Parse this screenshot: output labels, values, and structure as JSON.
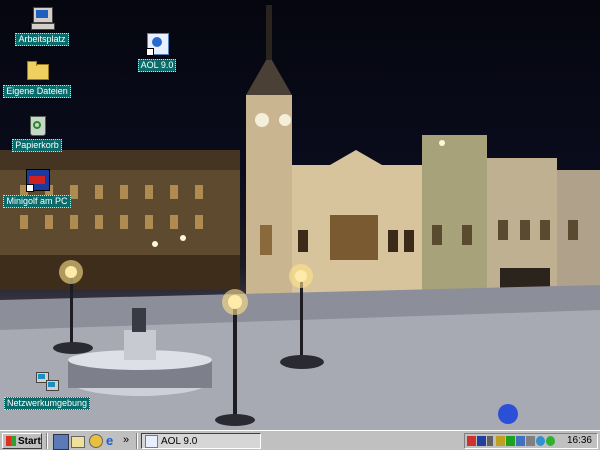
{
  "desktop": {
    "icons": [
      {
        "label": "Arbeitsplatz",
        "icon": "my-computer-icon"
      },
      {
        "label": "AOL 9.0",
        "icon": "aol-icon"
      },
      {
        "label": "Eigene Dateien",
        "icon": "my-documents-folder-icon"
      },
      {
        "label": "Papierkorb",
        "icon": "recycle-bin-icon"
      },
      {
        "label": "Minigolf am PC",
        "icon": "minigolf-game-icon"
      },
      {
        "label": "Netzwerkumgebung",
        "icon": "network-neighborhood-icon"
      }
    ],
    "wallpaper": "night-town-square-snow"
  },
  "taskbar": {
    "start_label": "Start",
    "quick_launch": [
      "show-desktop-icon",
      "outlook-express-icon",
      "media-player-icon",
      "internet-explorer-icon"
    ],
    "quick_launch_more": "»",
    "tasks": [
      {
        "label": "AOL 9.0",
        "icon": "aol-icon"
      }
    ],
    "tray_icons": [
      "antivirus-icon",
      "aol-tray-icon",
      "speaker-icon",
      "network-icon",
      "signal-icon",
      "display-icon",
      "printer-icon",
      "globe-icon",
      "messenger-icon"
    ],
    "clock": "16:36"
  },
  "colors": {
    "taskbar": "#c0c0c0",
    "icon_label_bg": "#0a6b6b",
    "task_selected": "#d6d6d6"
  }
}
